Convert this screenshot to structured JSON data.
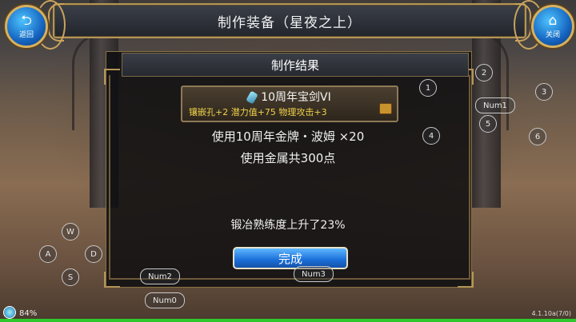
{
  "header": {
    "title": "制作装备（星夜之上）"
  },
  "buttons": {
    "back": {
      "glyph": "⮌",
      "label": "返回"
    },
    "close": {
      "glyph": "⌂",
      "label": "关闭"
    }
  },
  "panel": {
    "title": "制作结果",
    "item": {
      "name": "10周年宝剑VI",
      "stats": "镶嵌孔+2  潜力值+75  物理攻击+3"
    },
    "cost_line": "使用10周年金牌・波姆  ×20",
    "metal_line": "使用金属共300点",
    "skill_line": "锻冶熟练度上升了23%",
    "done_label": "完成"
  },
  "key_hints": {
    "c1": "1",
    "c2": "2",
    "c3": "3",
    "c4": "4",
    "c5": "5",
    "c6": "6",
    "num1": "Num1",
    "num2": "Num2",
    "num3": "Num3",
    "num0": "Num0",
    "w": "W",
    "a": "A",
    "s": "S",
    "d": "D"
  },
  "status": {
    "percent": "84%",
    "version": "4.1.10a(7/0)"
  },
  "colors": {
    "accent_gold": "#b39556",
    "button_blue": "#1a6ed8",
    "stat_yellow": "#f0d34a",
    "progress_green": "#2ec92e"
  }
}
